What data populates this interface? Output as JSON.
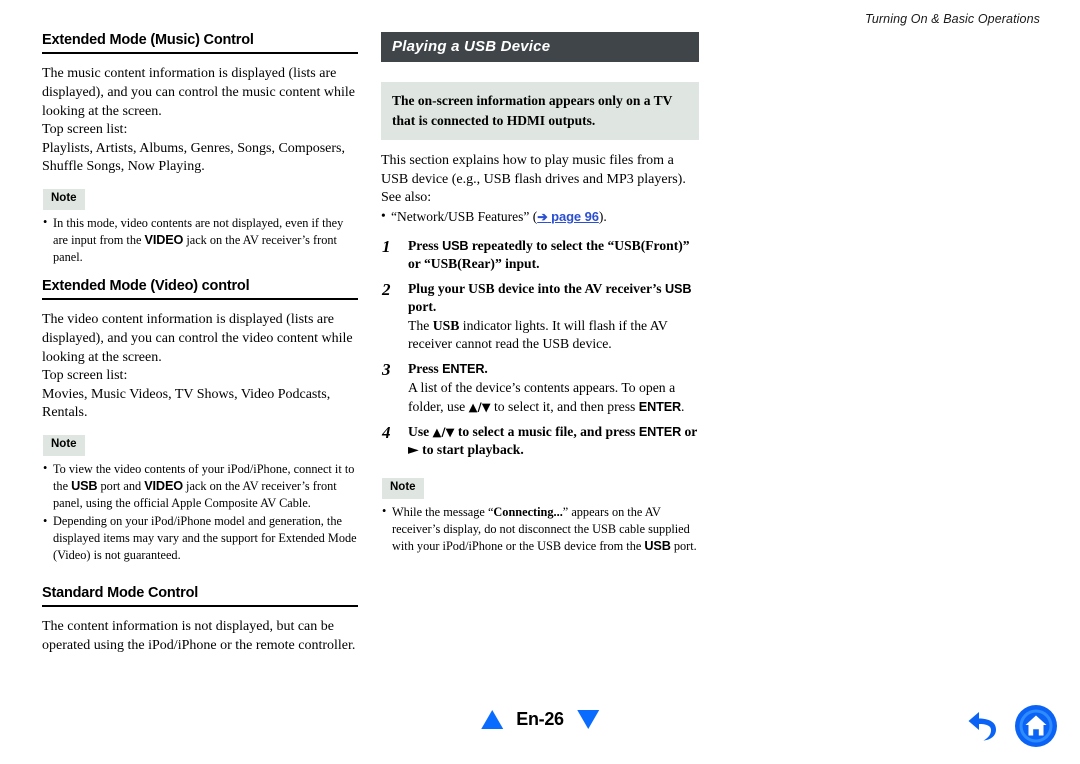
{
  "page": {
    "running_header": "Turning On & Basic Operations",
    "page_label": "En-26"
  },
  "colors": {
    "banner_bg": "#3f4548",
    "callout_bg": "#dfe6e1",
    "note_badge_bg": "#dfe6e1",
    "link_blue": "#2b4fd0",
    "pager_blue": "#0a6cff",
    "rule_black": "#000000"
  },
  "left_column": {
    "sections": [
      {
        "heading": "Extended Mode (Music) Control",
        "paragraphs": [
          "The music content information is displayed (lists are displayed), and you can control the music content while looking at the screen.",
          "Top screen list:",
          "Playlists, Artists, Albums, Genres, Songs, Composers, Shuffle Songs, Now Playing."
        ],
        "note_badge": "Note",
        "notes": [
          {
            "pre": "In this mode, video contents are not displayed, even if they are input from the ",
            "kbd": "VIDEO",
            "post": " jack on the AV receiver’s front panel."
          }
        ]
      },
      {
        "heading": "Extended Mode (Video) control",
        "paragraphs": [
          "The video content information is displayed (lists are displayed), and you can control the video content while looking at the screen.",
          "Top screen list:",
          "Movies, Music Videos, TV Shows, Video Podcasts, Rentals."
        ],
        "note_badge": "Note",
        "notes": [
          {
            "pre": "To view the video contents of your iPod/iPhone, connect it to the ",
            "kbd": "USB",
            "mid": " port and ",
            "kbd2": "VIDEO",
            "post": " jack on the AV receiver’s front panel, using the official Apple Composite AV Cable."
          },
          {
            "pre": "Depending on your iPod/iPhone model and generation, the displayed items may vary and the support for Extended Mode (Video) is not guaranteed."
          }
        ]
      },
      {
        "heading": "Standard Mode Control",
        "paragraphs": [
          "The content information is not displayed, but can be operated using the iPod/iPhone or the remote controller."
        ]
      }
    ]
  },
  "right_column": {
    "banner_title": "Playing a USB Device",
    "callout": "The on-screen information appears only on a TV that is connected to HDMI outputs.",
    "intro": "This section explains how to play music files from a USB device (e.g., USB flash drives and MP3 players).",
    "see_also_label": "See also:",
    "see_also": {
      "prefix": "“Network/USB Features” (",
      "link_arrow": "➔",
      "link_text": "page 96",
      "suffix": ")."
    },
    "steps": [
      {
        "num": "1",
        "title_pre": "Press ",
        "title_kbd": "USB",
        "title_post": " repeatedly to select the “USB(Front)” or “USB(Rear)” input.",
        "body": ""
      },
      {
        "num": "2",
        "title_pre": "Plug your USB device into the AV receiver’s ",
        "title_kbd": "USB",
        "title_post": " port.",
        "body_pre": "The ",
        "body_kbd": "USB",
        "body_post": " indicator lights. It will flash if the AV receiver cannot read the USB device."
      },
      {
        "num": "3",
        "title_pre": "Press ",
        "title_kbd": "ENTER",
        "title_post": ".",
        "body_pre": "A list of the device’s contents appears. To open a folder, use ",
        "body_glyph": "▲/▼",
        "body_mid": " to select it, and then press ",
        "body_kbd": "ENTER",
        "body_post": "."
      },
      {
        "num": "4",
        "title_pre": "Use ",
        "title_glyph": "▲/▼",
        "title_mid": " to select a music file, and press ",
        "title_kbd": "ENTER",
        "title_mid2": " or ",
        "title_glyph2": "►",
        "title_post": " to start playback."
      }
    ],
    "note_badge": "Note",
    "notes": [
      {
        "pre": "While the message “",
        "bold": "Connecting...",
        "mid": "” appears on the AV receiver’s display, do not disconnect the USB cable supplied with your iPod/iPhone or the USB device from the ",
        "kbd": "USB",
        "post": " port."
      }
    ]
  },
  "nav": {
    "back_icon": "back-arrow-icon",
    "home_icon": "home-icon",
    "prev_icon": "triangle-up-icon",
    "next_icon": "triangle-down-icon"
  }
}
